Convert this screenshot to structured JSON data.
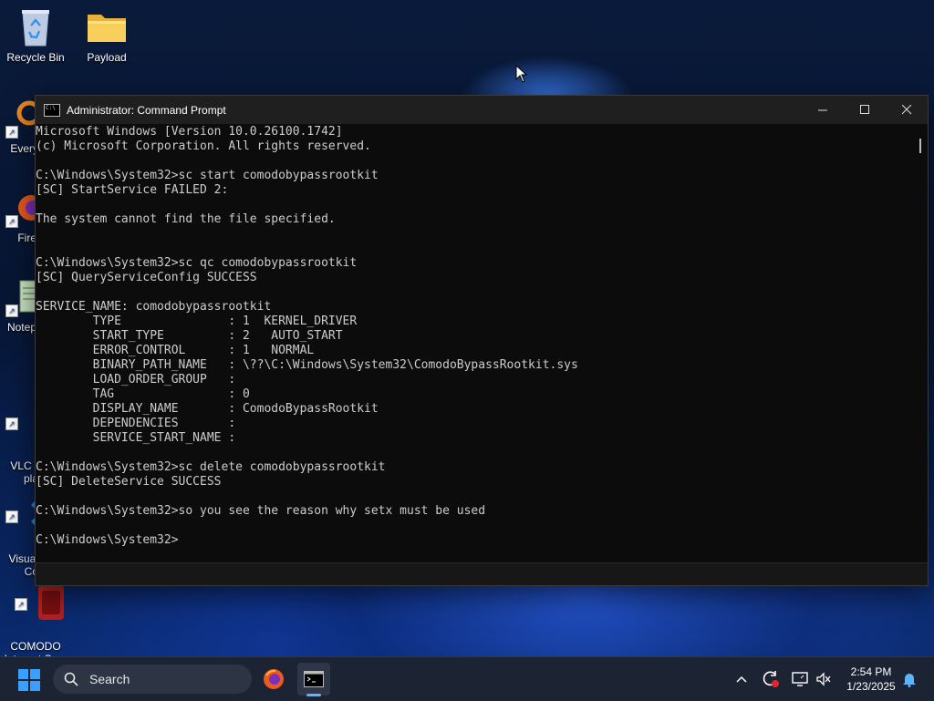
{
  "desktop": {
    "icons": [
      {
        "label": "Recycle Bin"
      },
      {
        "label": "Payload"
      },
      {
        "label": "Every"
      },
      {
        "label": "Fire"
      },
      {
        "label": "Notep"
      },
      {
        "label": "VLC r\npla"
      },
      {
        "label": "Visual\nCo"
      },
      {
        "label": "COMODO\nInternet Se..."
      }
    ]
  },
  "window": {
    "title": "Administrator: Command Prompt",
    "console_lines": [
      "Microsoft Windows [Version 10.0.26100.1742]",
      "(c) Microsoft Corporation. All rights reserved.",
      "",
      "C:\\Windows\\System32>sc start comodobypassrootkit",
      "[SC] StartService FAILED 2:",
      "",
      "The system cannot find the file specified.",
      "",
      "",
      "C:\\Windows\\System32>sc qc comodobypassrootkit",
      "[SC] QueryServiceConfig SUCCESS",
      "",
      "SERVICE_NAME: comodobypassrootkit",
      "        TYPE               : 1  KERNEL_DRIVER",
      "        START_TYPE         : 2   AUTO_START",
      "        ERROR_CONTROL      : 1   NORMAL",
      "        BINARY_PATH_NAME   : \\??\\C:\\Windows\\System32\\ComodoBypassRootkit.sys",
      "        LOAD_ORDER_GROUP   :",
      "        TAG                : 0",
      "        DISPLAY_NAME       : ComodoBypassRootkit",
      "        DEPENDENCIES       :",
      "        SERVICE_START_NAME :",
      "",
      "C:\\Windows\\System32>sc delete comodobypassrootkit",
      "[SC] DeleteService SUCCESS",
      "",
      "C:\\Windows\\System32>so you see the reason why setx must be used",
      "",
      "C:\\Windows\\System32>"
    ]
  },
  "taskbar": {
    "search_label": "Search",
    "clock_time": "2:54 PM",
    "clock_date": "1/23/2025"
  },
  "colors": {
    "console_bg": "#0c0c0c",
    "console_text": "#cccccc",
    "taskbar_bg": "#1c2433",
    "accent": "#3aa0ff"
  }
}
